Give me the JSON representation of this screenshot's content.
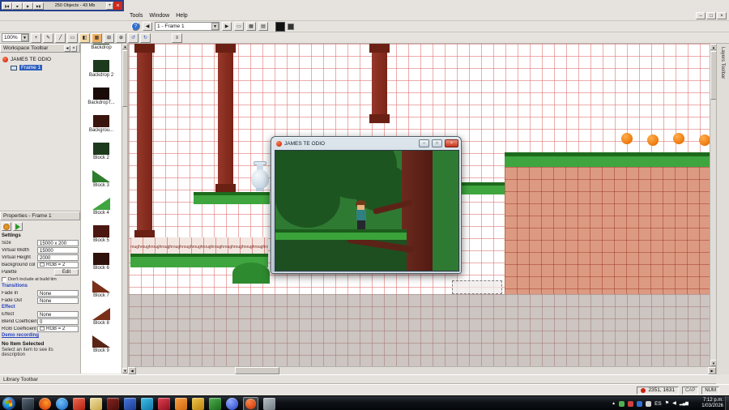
{
  "app": {
    "floating_toolbar": {
      "status": "250 Objects - 43 Mb",
      "buttons": [
        {
          "name": "skip-back-button",
          "glyph": "▮◀"
        },
        {
          "name": "stop-button",
          "glyph": "■"
        },
        {
          "name": "play-button",
          "glyph": "▶"
        },
        {
          "name": "skip-forward-button",
          "glyph": "▶▮"
        }
      ],
      "add_label": "+",
      "close_label": "×"
    },
    "menu_items": [
      "Tools",
      "Window",
      "Help"
    ],
    "window_controls": {
      "minimize": "–",
      "restore": "□",
      "close": "×"
    },
    "frame_selector": "1 - Frame 1",
    "zoom": "100%",
    "tools_a": [
      {
        "name": "help-icon",
        "glyph": "?"
      },
      {
        "name": "prev-frame-button",
        "glyph": "◀"
      },
      {
        "name": "next-frame-button",
        "glyph": "▶"
      },
      {
        "name": "outline-toggle-icon",
        "glyph": "▭"
      },
      {
        "name": "grid-view-toggle-icon",
        "glyph": "▦"
      },
      {
        "name": "list-view-toggle-icon",
        "glyph": "▤"
      }
    ],
    "tools_b": [
      {
        "name": "cursor-tool-icon",
        "glyph": "+"
      },
      {
        "name": "pencil-tool-icon",
        "glyph": "✎"
      },
      {
        "name": "line-tool-icon",
        "glyph": "╱"
      },
      {
        "name": "rect-tool-icon",
        "glyph": "▭"
      },
      {
        "name": "fill-tool-icon",
        "glyph": "◧"
      },
      {
        "name": "grid-toggle-icon",
        "glyph": "▦"
      },
      {
        "name": "snap-toggle-icon",
        "glyph": "⊞"
      },
      {
        "name": "zoom-tool-icon",
        "glyph": "⊕"
      },
      {
        "name": "undo-icon",
        "glyph": "↺"
      },
      {
        "name": "redo-icon",
        "glyph": "↻"
      },
      {
        "name": "menu-tool-icon",
        "glyph": "≡"
      }
    ]
  },
  "workspace": {
    "title": "Workspace Toolbar",
    "project": "JAMES TE ODIO",
    "frame": "Frame 1"
  },
  "properties": {
    "title": "Properties - Frame 1",
    "settings_header": "Settings",
    "rows": [
      {
        "label": "Size",
        "value": "15000 x 200"
      },
      {
        "label": "Virtual Width",
        "value": "15000"
      },
      {
        "label": "Virtual Height",
        "value": "2000"
      },
      {
        "label": "Background col",
        "value": "RGB = 2"
      },
      {
        "label": "Palette",
        "value": "Edit"
      }
    ],
    "dont_include_label": "Don't include at build tim",
    "transitions_header": "Transitions",
    "transition_rows": [
      {
        "label": "Fade In",
        "value": "None"
      },
      {
        "label": "Fade Out",
        "value": "None"
      }
    ],
    "effect_header": "Effect",
    "effect_rows": [
      {
        "label": "Effect",
        "value": "None"
      },
      {
        "label": "Blend Coefficien",
        "value": "0"
      },
      {
        "label": "RGB Coefficient",
        "value": "RGB = 2"
      }
    ],
    "demo_link": "Demo recording",
    "no_item_title": "No Item Selected",
    "no_item_text": "Select an item to see its description"
  },
  "library": {
    "items": [
      {
        "label": "Backdrop"
      },
      {
        "label": "Backdrop 2"
      },
      {
        "label": "BackdropT..."
      },
      {
        "label": "Backgrou..."
      },
      {
        "label": "Block 2"
      },
      {
        "label": "Block 3"
      },
      {
        "label": "Block 4"
      },
      {
        "label": "Block 5"
      },
      {
        "label": "Block 6"
      },
      {
        "label": "Block 7"
      },
      {
        "label": "Block 8"
      },
      {
        "label": "Block 9"
      }
    ]
  },
  "canvas": {
    "tile_text": "roughroughroughroughroughroughroughroughroughroughroughroughroughroughroughroughroughroughroughroughroughroughroughrough"
  },
  "game_window": {
    "title": "JAMES TE ODIO"
  },
  "layers_toolbar": {
    "title": "Layers Toolbar"
  },
  "library_toolbar": {
    "title": "Library Toolbar"
  },
  "status_bar": {
    "coordinates": "2351, 1631",
    "caps_label": "CAP",
    "num_label": "NUM"
  },
  "taskbar": {
    "language": "ES",
    "time": "7:12 p.m.",
    "date": "1/03/2026",
    "tray_expand": "▲",
    "icons": [
      "media-player",
      "firefox",
      "internet-explorer",
      "mail-client",
      "file-explorer",
      "maroon-app",
      "word-processor",
      "messenger",
      "red-app",
      "vlc",
      "gold-app",
      "green-app",
      "blue-orb-app",
      "game-editor",
      "gray-app"
    ]
  },
  "colors": {
    "grid_line": "#dd6a6a",
    "grass": "#3fa53f",
    "grass_edge": "#1d6b1d",
    "dirt": "#dd9a82",
    "column": "#8a2e20",
    "selection": "#2f5fbf",
    "taskbar": "#0e1216",
    "accent_close": "#d04632"
  }
}
